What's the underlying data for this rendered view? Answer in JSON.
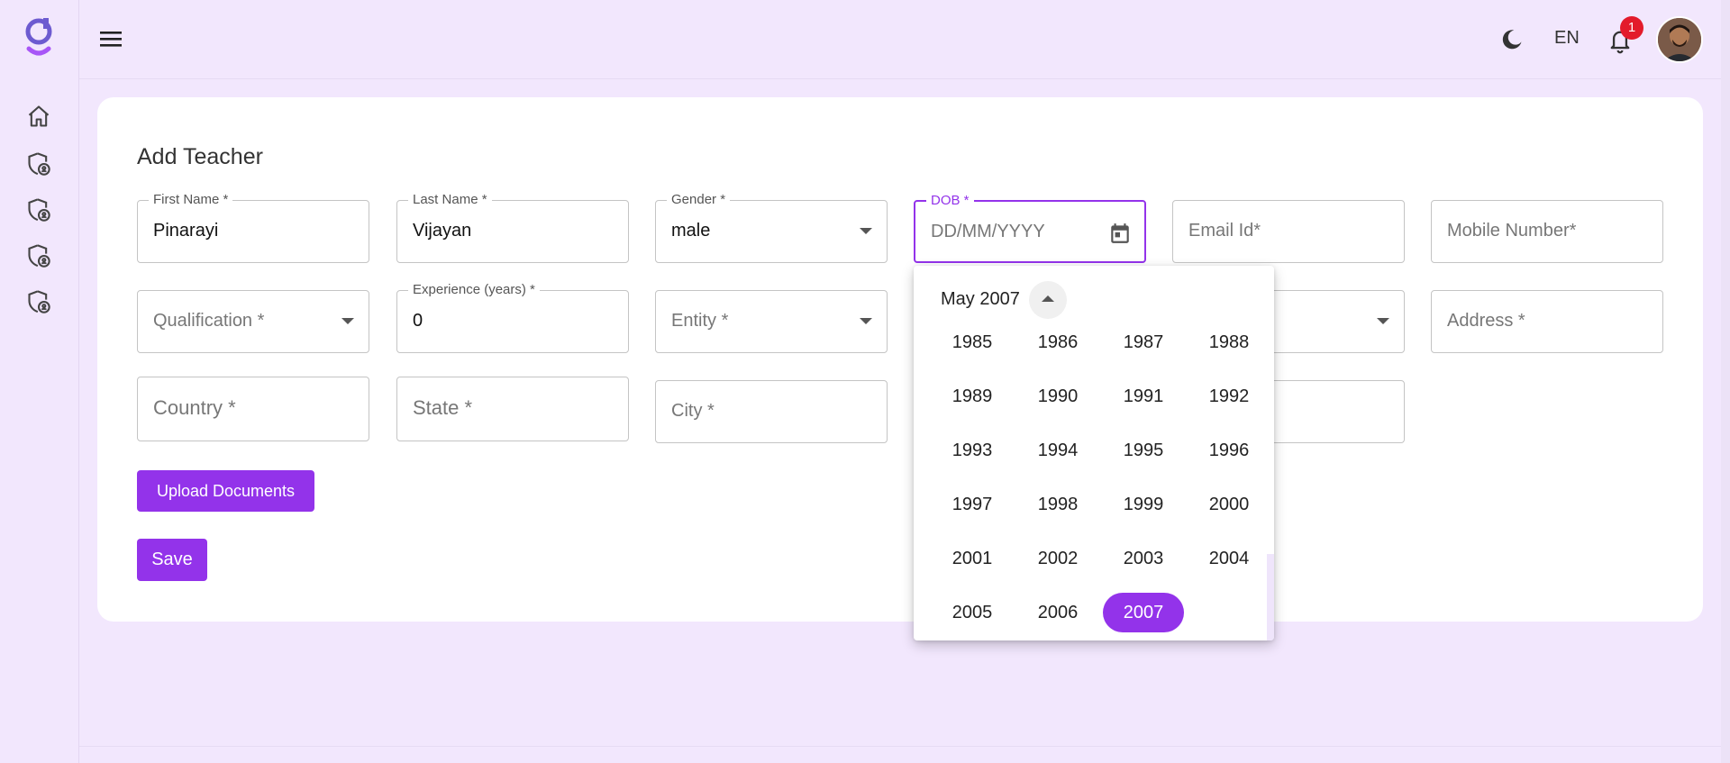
{
  "topbar": {
    "language": "EN",
    "notification_count": "1"
  },
  "sidebar": {
    "items": [
      {
        "icon": "home-icon"
      },
      {
        "icon": "shield-lock-icon"
      },
      {
        "icon": "shield-lock-icon"
      },
      {
        "icon": "shield-lock-icon"
      },
      {
        "icon": "shield-lock-icon"
      }
    ]
  },
  "form": {
    "title": "Add Teacher",
    "first_name": {
      "label": "First Name *",
      "value": "Pinarayi"
    },
    "last_name": {
      "label": "Last Name *",
      "value": "Vijayan"
    },
    "gender": {
      "label": "Gender *",
      "value": "male"
    },
    "dob": {
      "label": "DOB *",
      "placeholder": "DD/MM/YYYY"
    },
    "email": {
      "placeholder": "Email Id*"
    },
    "mobile": {
      "placeholder": "Mobile Number*"
    },
    "qualification": {
      "placeholder": "Qualification *"
    },
    "experience": {
      "label": "Experience (years) *",
      "value": "0"
    },
    "entity": {
      "placeholder": "Entity *"
    },
    "address": {
      "placeholder": "Address *"
    },
    "country": {
      "placeholder": "Country *"
    },
    "state": {
      "placeholder": "State *"
    },
    "city": {
      "placeholder": "City *"
    },
    "upload_label": "Upload Documents",
    "save_label": "Save"
  },
  "date_picker": {
    "header": "May 2007",
    "years": [
      "1985",
      "1986",
      "1987",
      "1988",
      "1989",
      "1990",
      "1991",
      "1992",
      "1993",
      "1994",
      "1995",
      "1996",
      "1997",
      "1998",
      "1999",
      "2000",
      "2001",
      "2002",
      "2003",
      "2004",
      "2005",
      "2006",
      "2007"
    ],
    "selected_year": "2007"
  },
  "colors": {
    "accent": "#9333ea",
    "background": "#f2e7fd",
    "badge": "#e31b2b"
  }
}
